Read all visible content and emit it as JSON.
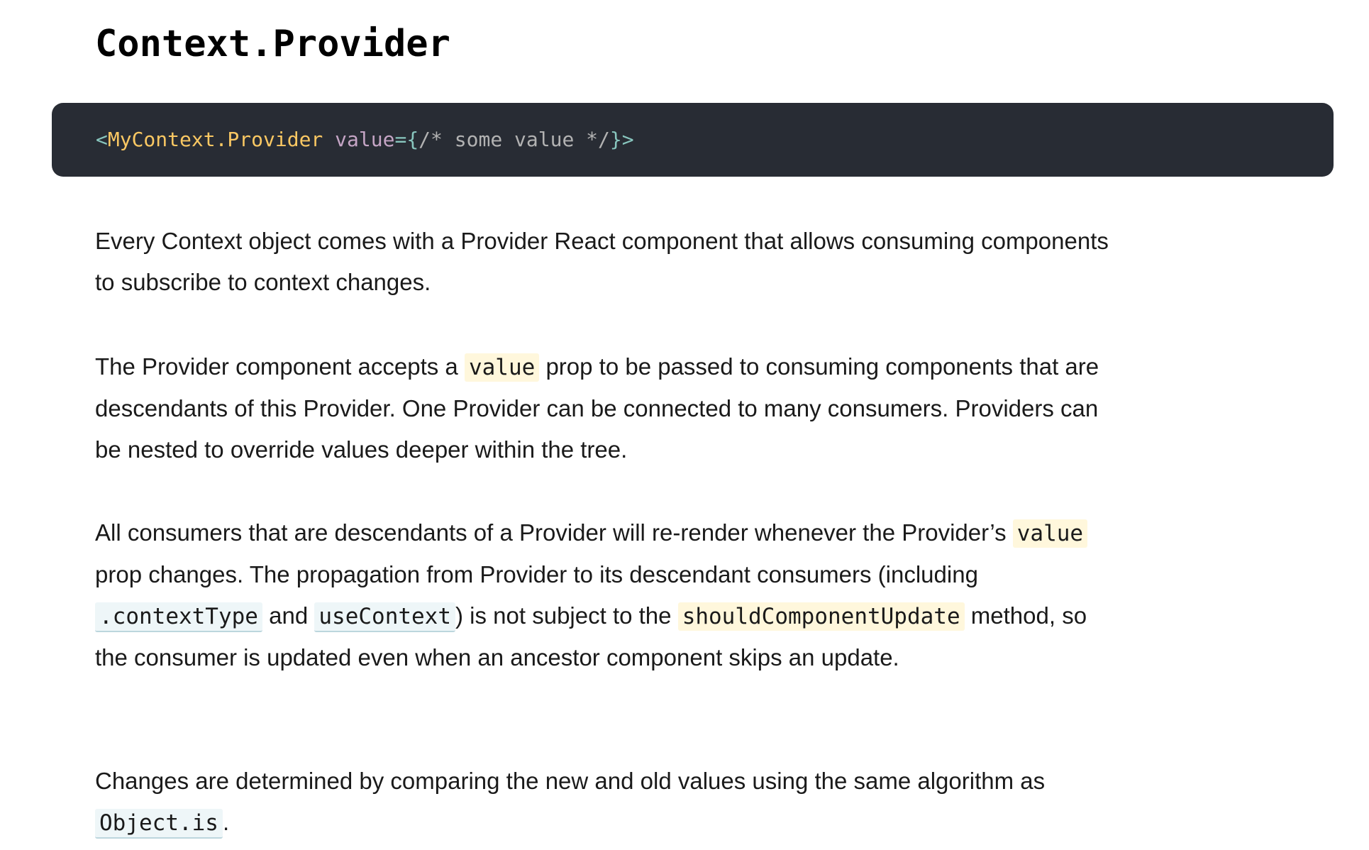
{
  "heading": "Context.Provider",
  "code_block": {
    "open_bracket": "<",
    "tag": "MyContext.Provider",
    "space": " ",
    "attr": "value",
    "equals": "=",
    "brace_open": "{",
    "comment": "/* some value */",
    "brace_close": "}",
    "close_bracket": ">"
  },
  "paragraphs": {
    "p1": {
      "text": "Every Context object comes with a Provider React component that allows consuming components to subscribe to context changes."
    },
    "p2": {
      "before": "The Provider component accepts a ",
      "code_value": "value",
      "after": " prop to be passed to consuming components that are descendants of this Provider. One Provider can be connected to many consumers. Providers can be nested to override values deeper within the tree."
    },
    "p3": {
      "part1": "All consumers that are descendants of a Provider will re-render whenever the Provider’s ",
      "code_value": "value",
      "part2": " prop changes. The propagation from Provider to its descendant consumers (including ",
      "code_context_type": ".contextType",
      "part3": " and ",
      "code_use_context": "useContext",
      "part4": ") is not subject to the ",
      "code_should_update": "shouldComponentUpdate",
      "part5": " method, so the consumer is updated even when an ancestor component skips an update."
    },
    "p4": {
      "before": "Changes are determined by comparing the new and old values using the same algorithm as ",
      "code_object_is": "Object.is",
      "after": "."
    }
  },
  "colors": {
    "code_background": "#282c34",
    "tag": "#fac863",
    "punctuation": "#88c6be",
    "attribute": "#c5a5c5",
    "comment": "#b2b2b2",
    "inline_code_yellow": "#fff7dc",
    "inline_code_blue": "#eef6f8"
  }
}
